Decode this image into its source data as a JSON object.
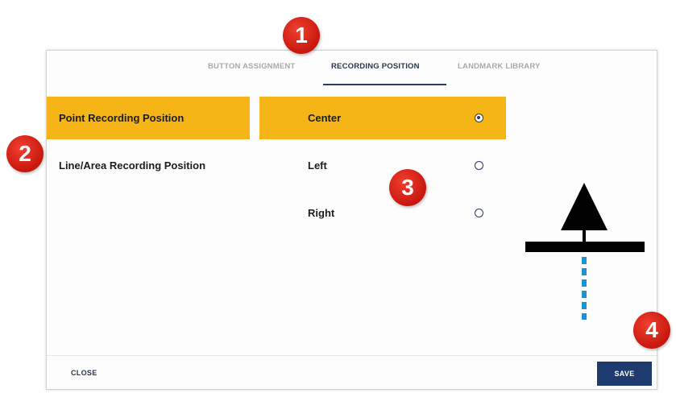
{
  "tabs": [
    "BUTTON ASSIGNMENT",
    "RECORDING POSITION",
    "LANDMARK LIBRARY"
  ],
  "active_tab": "RECORDING POSITION",
  "left_menu": [
    {
      "label": "Point Recording Position",
      "selected": true
    },
    {
      "label": "Line/Area Recording Position",
      "selected": false
    }
  ],
  "options": [
    {
      "label": "Center",
      "selected": true
    },
    {
      "label": "Left",
      "selected": false
    },
    {
      "label": "Right",
      "selected": false
    }
  ],
  "footer": {
    "close_label": "CLOSE",
    "save_label": "SAVE"
  },
  "callouts": [
    "1",
    "2",
    "3",
    "4"
  ],
  "colors": {
    "selection": "#f6b517",
    "primary": "#1f3a6e",
    "callout": "#d9231a",
    "marker_line": "#1e90d6",
    "marker": "#000000"
  },
  "illustration": {
    "icon": "point-recording-position-icon"
  }
}
